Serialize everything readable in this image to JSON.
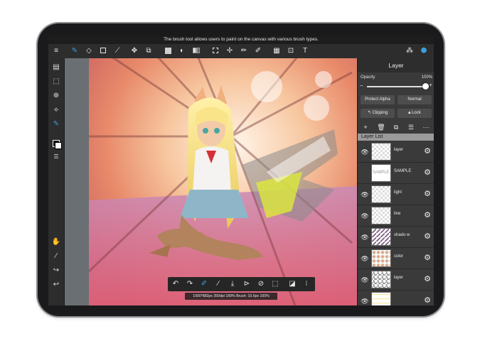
{
  "tooltip": "The brush tool allows users to paint on the canvas with various brush types.",
  "topbar": {
    "menu": "≡",
    "tools": [
      "✎",
      "◇",
      "□",
      "⟋",
      "✥",
      "⧉",
      "■",
      "◐",
      "▤",
      "⬚",
      "✢",
      "✏",
      "✐",
      "▦",
      "⊡",
      "T"
    ],
    "right_icons": [
      "⁂",
      "⬢"
    ]
  },
  "leftbar": {
    "top_icons": [
      "▤",
      "⬚",
      "⊕",
      "⟡",
      "✎"
    ],
    "bottom_icons": [
      "✋",
      "⁄",
      "↪",
      "↩"
    ]
  },
  "bottombar": {
    "icons": [
      "↶",
      "↷",
      "✐",
      "⁄",
      "⤓",
      "⊳",
      "⊘",
      "⬚",
      "◪",
      "⁝"
    ]
  },
  "status": "1000*882px 350dpi 189% Brush: 10.6px 100%",
  "panel": {
    "title": "Layer",
    "opacity_label": "Opacity",
    "opacity_value": "100%",
    "opacity": 1.0,
    "minus": "−",
    "plus": "+",
    "protect_alpha": "Protect Alpha",
    "blend_mode": "Normal",
    "clipping": "Clipping",
    "lock": "Lock",
    "icons": [
      "+",
      "🗑",
      "⧉",
      "☰",
      "⋯"
    ],
    "layer_list_title": "Layer List",
    "layers": [
      {
        "name": "layer",
        "visible": true,
        "thumb": "transparent"
      },
      {
        "name": "SAMPLE",
        "visible": false,
        "thumb": "sample"
      },
      {
        "name": "light",
        "visible": true,
        "thumb": "transparent"
      },
      {
        "name": "line",
        "visible": true,
        "thumb": "transparent"
      },
      {
        "name": "shado w",
        "visible": true,
        "thumb": "shadow"
      },
      {
        "name": "color",
        "visible": true,
        "thumb": "color"
      },
      {
        "name": "layer",
        "visible": true,
        "thumb": "sketch"
      },
      {
        "name": "",
        "visible": true,
        "thumb": "partial"
      }
    ]
  },
  "colors": {
    "accent": "#3aa0e0",
    "toolbar_bg": "#2d2d2d",
    "panel_bg": "#3a3a3a"
  }
}
